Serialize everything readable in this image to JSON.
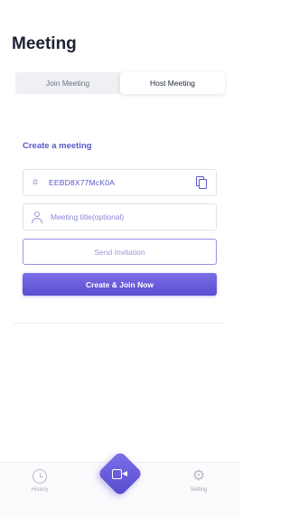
{
  "page": {
    "title": "Meeting"
  },
  "tabs": [
    {
      "label": "Join Meeting",
      "active": false
    },
    {
      "label": "Host Meeting",
      "active": true
    }
  ],
  "form": {
    "section_title": "Create a meeting",
    "meeting_code": "EEBD8X77McK0A",
    "meeting_title": {
      "value": "",
      "placeholder": "Meeting title(optional)"
    },
    "send_invitation_label": "Send Invitation",
    "create_join_label": "Create & Join Now"
  },
  "bottom_nav": {
    "history_label": "History",
    "setting_label": "Setting"
  },
  "colors": {
    "accent": "#5b57c8",
    "primary_button": "#6a5edb"
  }
}
